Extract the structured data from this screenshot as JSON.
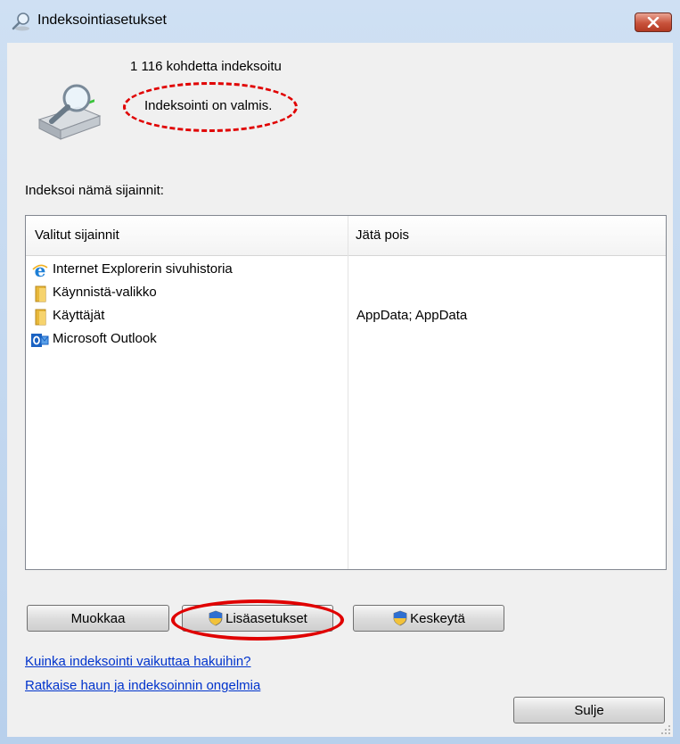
{
  "window": {
    "title": "Indeksointiasetukset"
  },
  "status": {
    "indexed_count": "1 116 kohdetta indeksoitu",
    "message": "Indeksointi on valmis."
  },
  "locations": {
    "section_label": "Indeksoi nämä sijainnit:",
    "columns": [
      "Valitut sijainnit",
      "Jätä pois"
    ],
    "rows": [
      {
        "icon": "internet-explorer-icon",
        "name": "Internet Explorerin sivuhistoria",
        "exclude": ""
      },
      {
        "icon": "folder-icon",
        "name": "Käynnistä-valikko",
        "exclude": ""
      },
      {
        "icon": "folder-icon",
        "name": "Käyttäjät",
        "exclude": "AppData; AppData"
      },
      {
        "icon": "outlook-icon",
        "name": "Microsoft Outlook",
        "exclude": ""
      }
    ]
  },
  "buttons": {
    "modify": "Muokkaa",
    "advanced": "Lisäasetukset",
    "pause": "Keskeytä",
    "close": "Sulje"
  },
  "links": {
    "how_indexing_affects": "Kuinka indeksointi vaikuttaa hakuihin?",
    "troubleshoot": "Ratkaise haun ja indeksoinnin ongelmia"
  },
  "colors": {
    "annotation_red": "#e00000",
    "link_blue": "#0033cc",
    "close_red": "#c8523b"
  }
}
